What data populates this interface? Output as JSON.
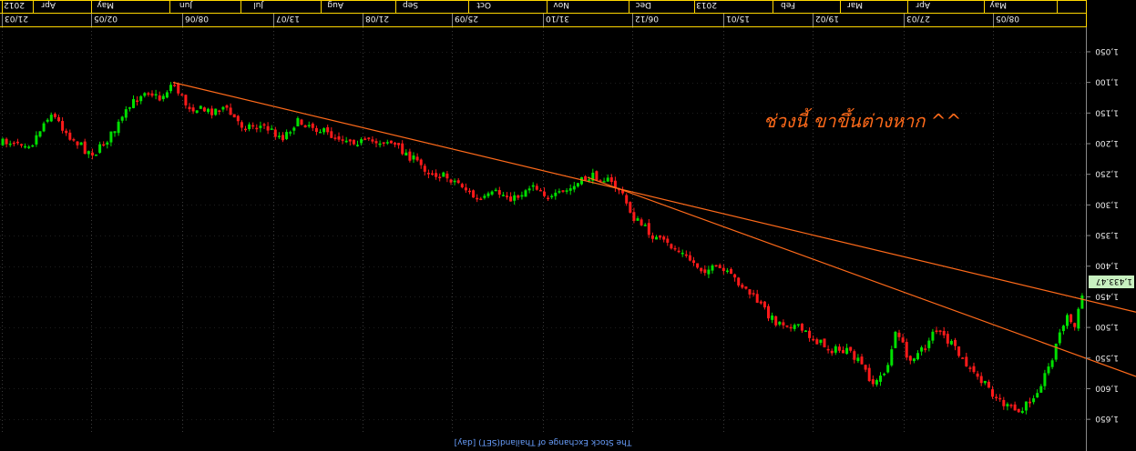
{
  "chart_data": {
    "type": "candlestick",
    "month_labels": [
      "2012",
      "Apr",
      "May",
      "Jun",
      "Jul",
      "Aug",
      "Sep",
      "Oct",
      "Nov",
      "Dec",
      "2013",
      "Feb",
      "Mar",
      "Apr",
      "May"
    ],
    "date_labels": [
      "21/03",
      "02/05",
      "08/06",
      "13/07",
      "21/08",
      "25/09",
      "31/10",
      "06/12",
      "15/01",
      "19/02",
      "27/03",
      "08/05"
    ],
    "y_ticks": [
      1050,
      1100,
      1150,
      1200,
      1250,
      1300,
      1350,
      1400,
      1450,
      1500,
      1550,
      1600,
      1650
    ],
    "ylim": [
      1010,
      1675
    ],
    "y_tick_labels": [
      "1,650",
      "1,600",
      "1,550",
      "1,500",
      "1,450",
      "1,400",
      "1,350",
      "1,300",
      "1,250",
      "1,200",
      "1,150",
      "1,100",
      "1,050"
    ],
    "last_price": "1,433.47",
    "annotation": "ช่วงนี้ ขาขึ้นต่างหาก ^^",
    "source": "The Stock Exchange of Thailand(SET) [day]",
    "grid": true,
    "colors": {
      "background": "#000000",
      "up_candle": "#00e000",
      "down_candle": "#ff1a1a",
      "trendline": "#ff6a1a",
      "month_header": "#ffd700",
      "grid": "#3a3a3a",
      "last_price_bg": "#c8f0c0"
    },
    "close_waypoints": [
      [
        0,
        1200
      ],
      [
        15,
        1195
      ],
      [
        35,
        1200
      ],
      [
        55,
        1148
      ],
      [
        75,
        1185
      ],
      [
        95,
        1212
      ],
      [
        105,
        1215
      ],
      [
        125,
        1180
      ],
      [
        145,
        1135
      ],
      [
        160,
        1110
      ],
      [
        175,
        1128
      ],
      [
        190,
        1100
      ],
      [
        205,
        1138
      ],
      [
        230,
        1148
      ],
      [
        245,
        1140
      ],
      [
        265,
        1170
      ],
      [
        290,
        1172
      ],
      [
        310,
        1190
      ],
      [
        325,
        1165
      ],
      [
        340,
        1168
      ],
      [
        360,
        1185
      ],
      [
        380,
        1192
      ],
      [
        400,
        1198
      ],
      [
        425,
        1195
      ],
      [
        445,
        1215
      ],
      [
        470,
        1245
      ],
      [
        490,
        1255
      ],
      [
        505,
        1265
      ],
      [
        525,
        1295
      ],
      [
        545,
        1280
      ],
      [
        565,
        1290
      ],
      [
        585,
        1265
      ],
      [
        605,
        1290
      ],
      [
        625,
        1275
      ],
      [
        645,
        1255
      ],
      [
        660,
        1253
      ],
      [
        680,
        1275
      ],
      [
        695,
        1320
      ],
      [
        720,
        1355
      ],
      [
        745,
        1375
      ],
      [
        770,
        1405
      ],
      [
        790,
        1405
      ],
      [
        810,
        1425
      ],
      [
        830,
        1455
      ],
      [
        850,
        1490
      ],
      [
        870,
        1495
      ],
      [
        890,
        1515
      ],
      [
        910,
        1535
      ],
      [
        930,
        1540
      ],
      [
        945,
        1560
      ],
      [
        960,
        1595
      ],
      [
        975,
        1560
      ],
      [
        985,
        1500
      ],
      [
        995,
        1550
      ],
      [
        1005,
        1545
      ],
      [
        1015,
        1535
      ],
      [
        1025,
        1500
      ],
      [
        1045,
        1530
      ],
      [
        1065,
        1570
      ],
      [
        1085,
        1600
      ],
      [
        1105,
        1630
      ],
      [
        1120,
        1640
      ],
      [
        1135,
        1610
      ],
      [
        1150,
        1570
      ],
      [
        1160,
        1525
      ],
      [
        1170,
        1480
      ],
      [
        1180,
        1500
      ],
      [
        1190,
        1433.47
      ]
    ],
    "trendlines": [
      {
        "from": [
          190,
          1100
        ],
        "to": [
          1247,
          1475
        ]
      },
      {
        "from": [
          645,
          1255
        ],
        "to": [
          1247,
          1580
        ]
      }
    ]
  }
}
